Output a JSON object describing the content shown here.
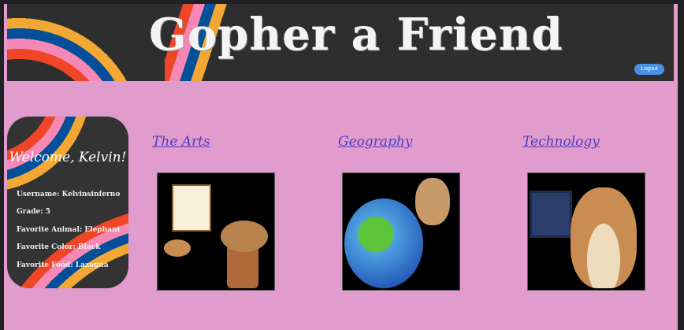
{
  "header": {
    "title": "Gopher a Friend",
    "logout_label": "Logout"
  },
  "profile": {
    "welcome": "Welcome, Kelvin!",
    "fields": [
      "Username: Kelvinsinferno",
      "Grade: 5",
      "Favorite Animal: Elephant",
      "Favorite Color: Black",
      "Favorite Food: Lazagna"
    ]
  },
  "categories": [
    {
      "label": "The Arts",
      "image": "gopher-painting-drum"
    },
    {
      "label": "Geography",
      "image": "gopher-globe"
    },
    {
      "label": "Technology",
      "image": "gopher-laptop"
    }
  ],
  "colors": {
    "background": "#e19bcd",
    "link": "#4b3fc4",
    "button": "#4a90e2"
  }
}
